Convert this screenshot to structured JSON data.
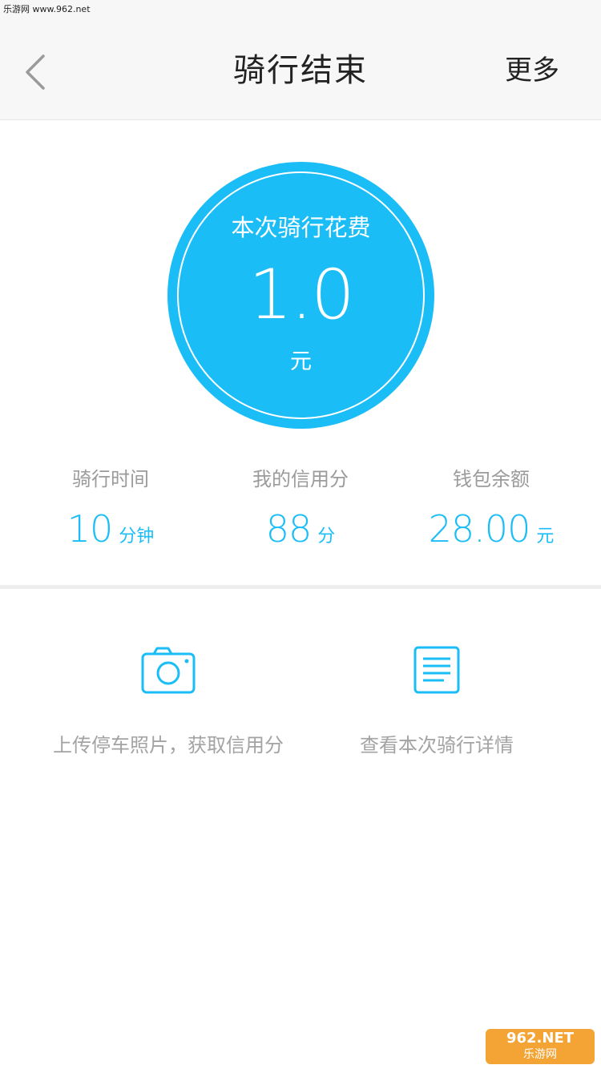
{
  "watermark_top": "乐游网 www.962.net",
  "header": {
    "title": "骑行结束",
    "more_label": "更多"
  },
  "cost": {
    "label": "本次骑行花费",
    "value": "1.0",
    "unit": "元"
  },
  "stats": [
    {
      "label": "骑行时间",
      "value": "10",
      "unit": "分钟"
    },
    {
      "label": "我的信用分",
      "value": "88",
      "unit": "分"
    },
    {
      "label": "钱包余额",
      "value": "28.00",
      "unit": "元"
    }
  ],
  "actions": [
    {
      "icon": "camera-icon",
      "label": "上传停车照片，获取信用分"
    },
    {
      "icon": "document-icon",
      "label": "查看本次骑行详情"
    }
  ],
  "watermark_bottom": {
    "line1": "962.NET",
    "line2": "乐游网"
  },
  "colors": {
    "accent": "#1bbdf7",
    "header_bg": "#f7f7f7",
    "muted_text": "#9b9b9b"
  }
}
